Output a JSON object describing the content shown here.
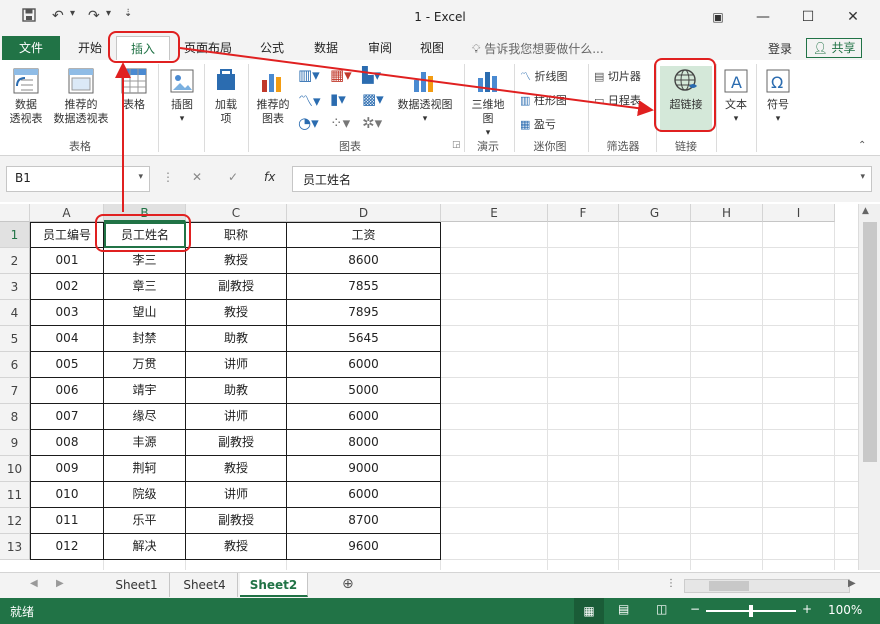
{
  "titlebar": {
    "title": "1 - Excel",
    "save_icon": "save-icon",
    "undo_icon": "undo-icon",
    "redo_icon": "redo-icon"
  },
  "tabs": {
    "file": "文件",
    "items": [
      "开始",
      "插入",
      "页面布局",
      "公式",
      "数据",
      "审阅",
      "视图"
    ],
    "active": "插入",
    "tellme": "告诉我您想要做什么...",
    "login": "登录",
    "share": "共享"
  },
  "ribbon": {
    "pivot_table": "数据\n透视表",
    "recommended_pivot": "推荐的\n数据透视表",
    "table": "表格",
    "group_tables": "表格",
    "illustrations": "插图",
    "addins": "加载\n项",
    "recommended_charts": "推荐的\n图表",
    "pivot_chart": "数据透视图",
    "group_charts": "图表",
    "map3d": "三维地\n图",
    "group_tours": "演示",
    "spark_line": "折线图",
    "spark_column": "柱形图",
    "spark_winloss": "盈亏",
    "group_sparklines": "迷你图",
    "slicer": "切片器",
    "timeline": "日程表",
    "group_filters": "筛选器",
    "hyperlink": "超链接",
    "group_links": "链接",
    "text": "文本",
    "symbols": "符号"
  },
  "formula_bar": {
    "namebox": "B1",
    "fx": "fx",
    "value": "员工姓名"
  },
  "columns": [
    "A",
    "B",
    "C",
    "D",
    "E",
    "F",
    "G",
    "H",
    "I"
  ],
  "rows": [
    "1",
    "2",
    "3",
    "4",
    "5",
    "6",
    "7",
    "8",
    "9",
    "10",
    "11",
    "12",
    "13"
  ],
  "table": {
    "headers": [
      "员工编号",
      "员工姓名",
      "职称",
      "工资"
    ],
    "data": [
      [
        "001",
        "李三",
        "教授",
        "8600"
      ],
      [
        "002",
        "章三",
        "副教授",
        "7855"
      ],
      [
        "003",
        "望山",
        "教授",
        "7895"
      ],
      [
        "004",
        "封禁",
        "助教",
        "5645"
      ],
      [
        "005",
        "万贯",
        "讲师",
        "6000"
      ],
      [
        "006",
        "靖宇",
        "助教",
        "5000"
      ],
      [
        "007",
        "缘尽",
        "讲师",
        "6000"
      ],
      [
        "008",
        "丰源",
        "副教授",
        "8000"
      ],
      [
        "009",
        "荆轲",
        "教授",
        "9000"
      ],
      [
        "010",
        "院级",
        "讲师",
        "6000"
      ],
      [
        "011",
        "乐平",
        "副教授",
        "8700"
      ],
      [
        "012",
        "解决",
        "教授",
        "9600"
      ]
    ]
  },
  "sheets": [
    "Sheet1",
    "Sheet4",
    "Sheet2"
  ],
  "active_sheet": "Sheet2",
  "status": {
    "ready": "就绪",
    "zoom": "100%"
  },
  "colors": {
    "excel_green": "#217346",
    "highlight_red": "#e02020"
  }
}
